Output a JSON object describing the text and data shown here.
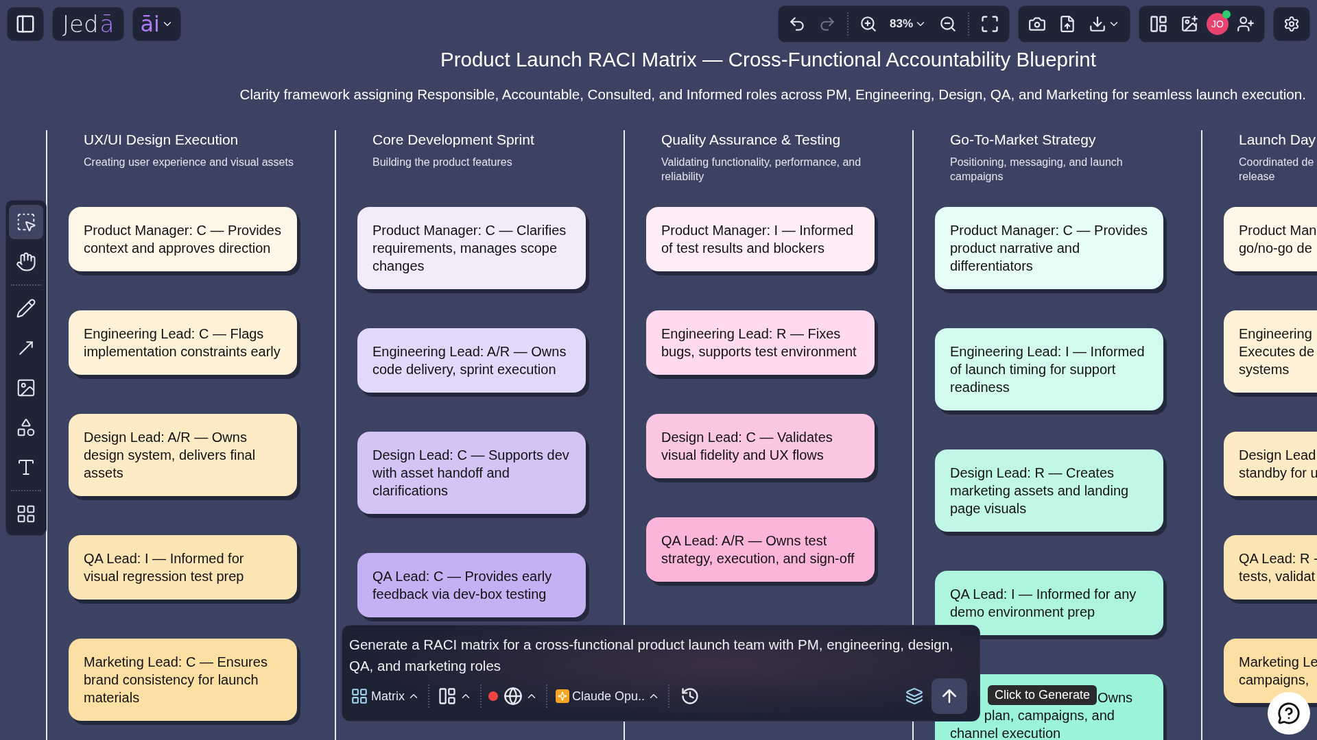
{
  "topbar": {
    "logo": "Jedā",
    "ai_label": "āi",
    "undo": {
      "disabled": false
    },
    "redo": {
      "disabled": true
    },
    "zoom": "83%",
    "avatar": "JO"
  },
  "tools": [
    {
      "kind": "select",
      "selected": true
    },
    {
      "kind": "hand",
      "selected": false
    },
    {
      "kind": "pencil",
      "selected": false
    },
    {
      "kind": "arrow",
      "selected": false
    },
    {
      "kind": "image",
      "selected": false
    },
    {
      "kind": "shapes",
      "selected": false
    },
    {
      "kind": "text",
      "selected": false
    },
    {
      "kind": "grid",
      "selected": false
    }
  ],
  "title": "Product Launch RACI Matrix — Cross-Functional Accountability Blueprint",
  "subtitle": "Clarity framework assigning Responsible, Accountable, Consulted, and Informed roles across PM, Engineering, Design, QA, and Marketing for seamless launch execution.",
  "columns": [
    {
      "title": "UX/UI Design Execution",
      "description": "Creating user experience and visual assets",
      "color": "#fbdfa3",
      "cards": [
        "Product Manager: C — Provides context and approves direction",
        "Engineering Lead: C — Flags implementation constraints early",
        "Design Lead: A/R — Owns design system, delivers final assets",
        "QA Lead: I — Informed for visual regression test prep",
        "Marketing Lead: C — Ensures brand consistency for launch materials"
      ]
    },
    {
      "title": "Core Development Sprint",
      "description": "Building the product features",
      "color": "#c5b0f3",
      "cards": [
        "Product Manager: C — Clarifies requirements, manages scope changes",
        "Engineering Lead: A/R — Owns code delivery, sprint execution",
        "Design Lead: C — Supports dev with asset handoff and clarifications",
        "QA Lead: C — Provides early feedback via dev-box testing"
      ]
    },
    {
      "title": "Quality Assurance & Testing",
      "description": "Validating functionality, performance, and reliability",
      "color": "#fbb4da",
      "cards": [
        "Product Manager: I — Informed of test results and blockers",
        "Engineering Lead: R — Fixes bugs, supports test environment",
        "Design Lead: C — Validates visual fidelity and UX flows",
        "QA Lead: A/R — Owns test strategy, execution, and sign-off"
      ]
    },
    {
      "title": "Go-To-Market Strategy",
      "description": "Positioning, messaging, and launch campaigns",
      "color": "#9bf3d9",
      "cards": [
        "Product Manager: C — Provides product narrative and differentiators",
        "Engineering Lead: I — Informed of launch timing for support readiness",
        "Design Lead: R — Creates marketing assets and landing page visuals",
        "QA Lead: I — Informed for any demo environment prep",
        {
          "kind": "covered",
          "lines": [
            "Owns",
            "plan, campaigns, and",
            "channel execution"
          ]
        }
      ]
    },
    {
      "title": "Launch Day",
      "description": "Coordinated de\nrelease",
      "color": "#fbdfa3",
      "cut": true,
      "cards": [
        "Product Man\ngo/no-go de",
        "Engineering\nExecutes de\nsystems",
        "Design Lead\nstandby for u",
        "QA Lead: R -\ntests, validat",
        "Marketing Le\ncampaigns,"
      ]
    }
  ],
  "prompt": {
    "value": "Generate a RACI matrix for a cross-functional product launch team with PM, engineering, design, QA, and marketing roles",
    "mode": "Matrix",
    "model": "Claude Opu..",
    "tooltip": "Click to Generate"
  }
}
